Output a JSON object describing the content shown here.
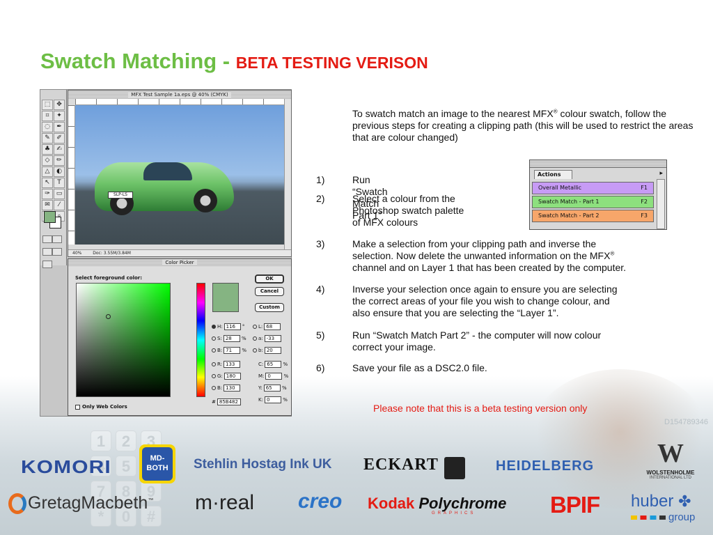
{
  "title": {
    "main": "Swatch Matching - ",
    "sub": "BETA TESTING VERISON"
  },
  "photoshop": {
    "document_title": "MFX Test Sample 1a.eps @ 40% (CMYK)",
    "zoom": "40%",
    "doc_size": "Doc: 3.55M/3.84M",
    "car_plate": "SLP-LS",
    "picker_title": "Color Picker",
    "picker_label": "Select foreground color:",
    "buttons": {
      "ok": "OK",
      "cancel": "Cancel",
      "custom": "Custom"
    },
    "values": {
      "H": "116",
      "S": "28",
      "B": "71",
      "R": "133",
      "G": "180",
      "Bv": "130",
      "L": "68",
      "a": "-33",
      "b": "20",
      "C": "65",
      "M": "0",
      "Y": "65",
      "K": "0",
      "hex": "85B482"
    },
    "labels": {
      "H": "H:",
      "S": "S:",
      "B": "B:",
      "R": "R:",
      "G": "G:",
      "Bv": "B:",
      "L": "L:",
      "a": "a:",
      "b": "b:",
      "C": "C:",
      "M": "M:",
      "Y": "Y:",
      "K": "K:",
      "hash": "#",
      "deg": "°",
      "pct": "%"
    },
    "web_colors": "Only Web Colors",
    "colors": {
      "foreground": "#85b482"
    }
  },
  "intro": {
    "text_a": "To swatch match an image to the nearest MFX",
    "reg": "®",
    "text_b": " colour swatch, follow the previous steps for creating a clipping path (this will be used to restrict the areas that are colour changed)"
  },
  "steps": [
    {
      "n": "1)",
      "lines": [
        "Run “Swatch Match Part 1”"
      ]
    },
    {
      "n": "2)",
      "lines": [
        "Select a colour from the",
        "Photoshop swatch palette",
        "of MFX colours"
      ]
    },
    {
      "n": "3)",
      "line1": "Make a selection from your clipping path and inverse the",
      "line2": "selection. Now delete the unwanted information on the MFX",
      "reg": "®",
      "line3": "channel and on Layer 1 that has been created by the computer."
    },
    {
      "n": "4)",
      "lines": [
        "Inverse your selection once again to ensure you are selecting",
        "the correct areas of your file you wish to change colour, and",
        "also ensure that you are selecting the “Layer 1”."
      ]
    },
    {
      "n": "5)",
      "lines": [
        "Run “Swatch Match Part 2” - the computer will now colour",
        "correct your image."
      ]
    },
    {
      "n": "6)",
      "lines": [
        "Save your file as a DSC2.0 file."
      ]
    }
  ],
  "actions_palette": {
    "tab": "Actions",
    "menu_icon": "triangle-right-icon",
    "rows": [
      {
        "label": "Overall Metallic",
        "key": "F1",
        "color": "#c79bf5"
      },
      {
        "label": "Swatch Match  - Part 1",
        "key": "F2",
        "color": "#8de07e"
      },
      {
        "label": "Swatch Match  - Part 2",
        "key": "F3",
        "color": "#f7a66a"
      }
    ]
  },
  "note": "Please note that this is a beta testing version only",
  "logos": {
    "komori": "KOMORI",
    "mdboth_top": "MD-",
    "mdboth_bottom": "BOTH",
    "stehlin": "Stehlin Hostag Ink UK",
    "eckart": "ECKART",
    "heidelberg": "HEIDELBERG",
    "wolstenholme_name": "WOLSTENHOLME",
    "wolstenholme_sub": "INTERNATIONAL LTD",
    "gretag": "GretagMacbeth",
    "gretag_tm": "™",
    "mreal": "m·real",
    "creo": "creo",
    "kodak": "Kodak",
    "polychrome": "Polychrome",
    "polychrome_sub": "GRAPHICS",
    "bpif": "BPIF",
    "huber": "huber",
    "huber_group": "group"
  },
  "background": {
    "keys": [
      "1",
      "2",
      "3",
      "4",
      "5",
      "6",
      "7",
      "8",
      "9",
      "*",
      "0",
      "#"
    ],
    "number": "D154789346"
  },
  "accent_colors": {
    "title_green": "#6dbe45",
    "title_red": "#e41b13"
  }
}
